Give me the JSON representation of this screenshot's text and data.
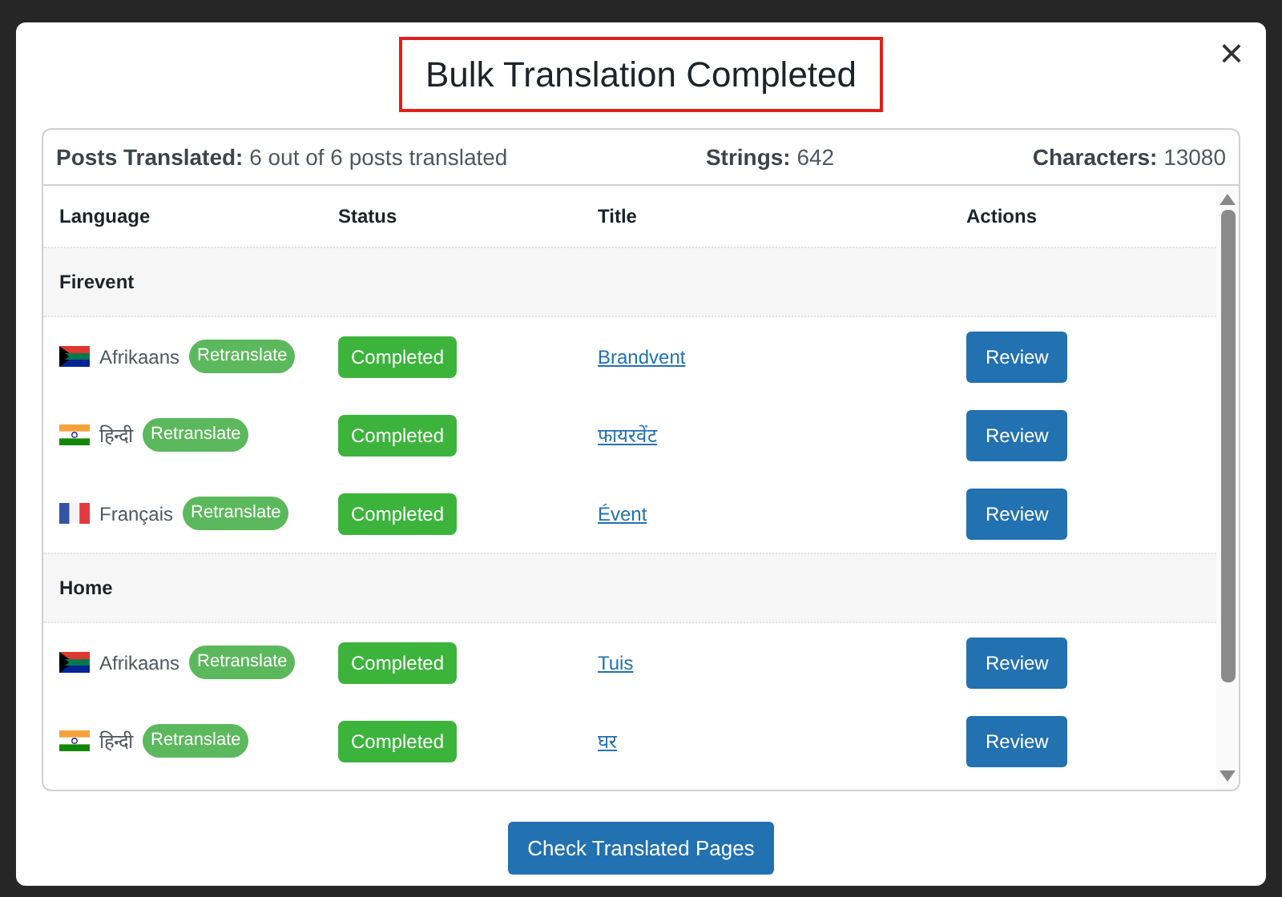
{
  "dialog": {
    "title": "Bulk Translation Completed",
    "close": "×"
  },
  "summary": [
    {
      "label": "Posts Translated:",
      "value": "6 out of 6 posts translated"
    },
    {
      "label": "Strings:",
      "value": "642"
    },
    {
      "label": "Characters:",
      "value": "13080"
    }
  ],
  "table": {
    "columns": [
      "Language",
      "Status",
      "Title",
      "Actions"
    ],
    "groups": [
      {
        "name": "Firevent",
        "rows": [
          {
            "kind": "za",
            "language": "Afrikaans",
            "badge": "Retranslate",
            "status": "Completed",
            "title": "Brandvent",
            "action": "Review"
          },
          {
            "kind": "in",
            "language": "हिन्दी",
            "badge": "Retranslate",
            "status": "Completed",
            "title": "फायरवेंट",
            "action": "Review"
          },
          {
            "kind": "fr",
            "language": "Français",
            "badge": "Retranslate",
            "status": "Completed",
            "title": "Évent",
            "action": "Review"
          }
        ]
      },
      {
        "name": "Home",
        "rows": [
          {
            "kind": "za",
            "language": "Afrikaans",
            "badge": "Retranslate",
            "status": "Completed",
            "title": "Tuis",
            "action": "Review"
          },
          {
            "kind": "in",
            "language": "हिन्दी",
            "badge": "Retranslate",
            "status": "Completed",
            "title": "घर",
            "action": "Review"
          }
        ]
      }
    ]
  },
  "footer_button": "Check Translated Pages"
}
